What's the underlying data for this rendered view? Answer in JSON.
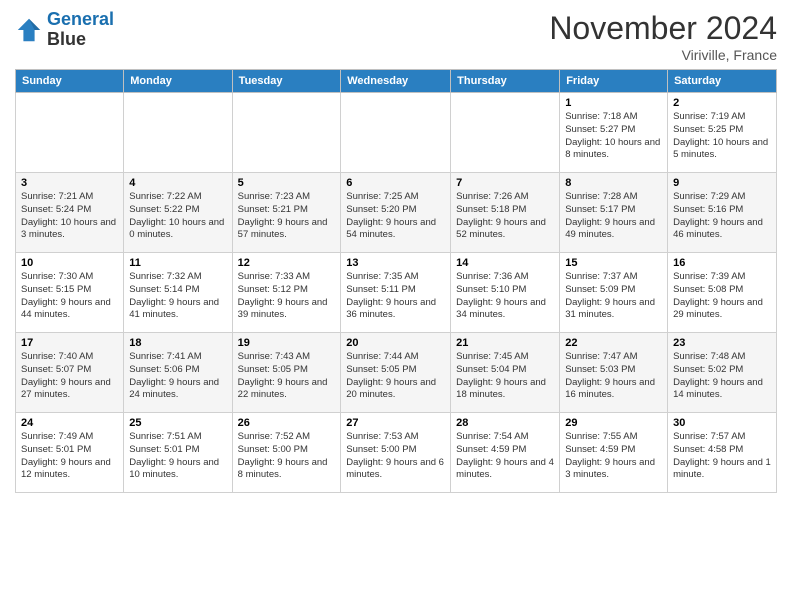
{
  "header": {
    "logo_line1": "General",
    "logo_line2": "Blue",
    "title": "November 2024",
    "location": "Viriville, France"
  },
  "weekdays": [
    "Sunday",
    "Monday",
    "Tuesday",
    "Wednesday",
    "Thursday",
    "Friday",
    "Saturday"
  ],
  "weeks": [
    [
      {
        "day": "",
        "info": ""
      },
      {
        "day": "",
        "info": ""
      },
      {
        "day": "",
        "info": ""
      },
      {
        "day": "",
        "info": ""
      },
      {
        "day": "",
        "info": ""
      },
      {
        "day": "1",
        "info": "Sunrise: 7:18 AM\nSunset: 5:27 PM\nDaylight: 10 hours\nand 8 minutes."
      },
      {
        "day": "2",
        "info": "Sunrise: 7:19 AM\nSunset: 5:25 PM\nDaylight: 10 hours\nand 5 minutes."
      }
    ],
    [
      {
        "day": "3",
        "info": "Sunrise: 7:21 AM\nSunset: 5:24 PM\nDaylight: 10 hours\nand 3 minutes."
      },
      {
        "day": "4",
        "info": "Sunrise: 7:22 AM\nSunset: 5:22 PM\nDaylight: 10 hours\nand 0 minutes."
      },
      {
        "day": "5",
        "info": "Sunrise: 7:23 AM\nSunset: 5:21 PM\nDaylight: 9 hours\nand 57 minutes."
      },
      {
        "day": "6",
        "info": "Sunrise: 7:25 AM\nSunset: 5:20 PM\nDaylight: 9 hours\nand 54 minutes."
      },
      {
        "day": "7",
        "info": "Sunrise: 7:26 AM\nSunset: 5:18 PM\nDaylight: 9 hours\nand 52 minutes."
      },
      {
        "day": "8",
        "info": "Sunrise: 7:28 AM\nSunset: 5:17 PM\nDaylight: 9 hours\nand 49 minutes."
      },
      {
        "day": "9",
        "info": "Sunrise: 7:29 AM\nSunset: 5:16 PM\nDaylight: 9 hours\nand 46 minutes."
      }
    ],
    [
      {
        "day": "10",
        "info": "Sunrise: 7:30 AM\nSunset: 5:15 PM\nDaylight: 9 hours\nand 44 minutes."
      },
      {
        "day": "11",
        "info": "Sunrise: 7:32 AM\nSunset: 5:14 PM\nDaylight: 9 hours\nand 41 minutes."
      },
      {
        "day": "12",
        "info": "Sunrise: 7:33 AM\nSunset: 5:12 PM\nDaylight: 9 hours\nand 39 minutes."
      },
      {
        "day": "13",
        "info": "Sunrise: 7:35 AM\nSunset: 5:11 PM\nDaylight: 9 hours\nand 36 minutes."
      },
      {
        "day": "14",
        "info": "Sunrise: 7:36 AM\nSunset: 5:10 PM\nDaylight: 9 hours\nand 34 minutes."
      },
      {
        "day": "15",
        "info": "Sunrise: 7:37 AM\nSunset: 5:09 PM\nDaylight: 9 hours\nand 31 minutes."
      },
      {
        "day": "16",
        "info": "Sunrise: 7:39 AM\nSunset: 5:08 PM\nDaylight: 9 hours\nand 29 minutes."
      }
    ],
    [
      {
        "day": "17",
        "info": "Sunrise: 7:40 AM\nSunset: 5:07 PM\nDaylight: 9 hours\nand 27 minutes."
      },
      {
        "day": "18",
        "info": "Sunrise: 7:41 AM\nSunset: 5:06 PM\nDaylight: 9 hours\nand 24 minutes."
      },
      {
        "day": "19",
        "info": "Sunrise: 7:43 AM\nSunset: 5:05 PM\nDaylight: 9 hours\nand 22 minutes."
      },
      {
        "day": "20",
        "info": "Sunrise: 7:44 AM\nSunset: 5:05 PM\nDaylight: 9 hours\nand 20 minutes."
      },
      {
        "day": "21",
        "info": "Sunrise: 7:45 AM\nSunset: 5:04 PM\nDaylight: 9 hours\nand 18 minutes."
      },
      {
        "day": "22",
        "info": "Sunrise: 7:47 AM\nSunset: 5:03 PM\nDaylight: 9 hours\nand 16 minutes."
      },
      {
        "day": "23",
        "info": "Sunrise: 7:48 AM\nSunset: 5:02 PM\nDaylight: 9 hours\nand 14 minutes."
      }
    ],
    [
      {
        "day": "24",
        "info": "Sunrise: 7:49 AM\nSunset: 5:01 PM\nDaylight: 9 hours\nand 12 minutes."
      },
      {
        "day": "25",
        "info": "Sunrise: 7:51 AM\nSunset: 5:01 PM\nDaylight: 9 hours\nand 10 minutes."
      },
      {
        "day": "26",
        "info": "Sunrise: 7:52 AM\nSunset: 5:00 PM\nDaylight: 9 hours\nand 8 minutes."
      },
      {
        "day": "27",
        "info": "Sunrise: 7:53 AM\nSunset: 5:00 PM\nDaylight: 9 hours\nand 6 minutes."
      },
      {
        "day": "28",
        "info": "Sunrise: 7:54 AM\nSunset: 4:59 PM\nDaylight: 9 hours\nand 4 minutes."
      },
      {
        "day": "29",
        "info": "Sunrise: 7:55 AM\nSunset: 4:59 PM\nDaylight: 9 hours\nand 3 minutes."
      },
      {
        "day": "30",
        "info": "Sunrise: 7:57 AM\nSunset: 4:58 PM\nDaylight: 9 hours\nand 1 minute."
      }
    ]
  ]
}
